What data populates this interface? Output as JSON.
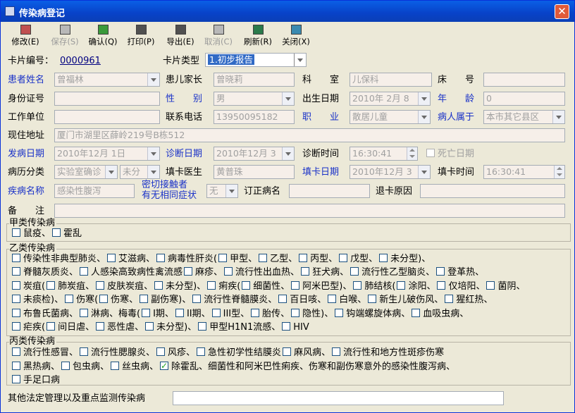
{
  "window": {
    "title": "传染病登记"
  },
  "toolbar": [
    {
      "label": "修改(E)",
      "icon": "edit-icon",
      "enabled": true
    },
    {
      "label": "保存(S)",
      "icon": "save-icon",
      "enabled": false
    },
    {
      "label": "确认(Q)",
      "icon": "confirm-icon",
      "enabled": true
    },
    {
      "label": "打印(P)",
      "icon": "print-icon",
      "enabled": true
    },
    {
      "label": "导出(E)",
      "icon": "export-icon",
      "enabled": true
    },
    {
      "label": "取消(C)",
      "icon": "cancel-icon",
      "enabled": false
    },
    {
      "label": "刷新(R)",
      "icon": "refresh-icon",
      "enabled": true
    },
    {
      "label": "关闭(X)",
      "icon": "close-icon",
      "enabled": true
    }
  ],
  "form": {
    "card_no_label": "卡片编号：",
    "card_no": "0000961",
    "card_type_label": "卡片类型",
    "card_type": "1.初步报告",
    "patient_name_label": "患者姓名",
    "patient_name": "曾福林",
    "guardian_label": "患儿家长",
    "guardian": "曾晓莉",
    "dept_label": "科　　室",
    "dept": "儿保科",
    "bed_label": "床　　号",
    "bed": "",
    "id_label": "身份证号",
    "id_no": "",
    "sex_label": "性　　别",
    "sex": "男",
    "birth_label": "出生日期",
    "birth": "2010年 2月 8",
    "age_label": "年　　龄",
    "age": "0",
    "work_label": "工作单位",
    "work": "",
    "phone_label": "联系电话",
    "phone": "13950095182",
    "job_label": "职　　业",
    "job": "散居儿童",
    "belong_label": "病人属于",
    "belong": "本市其它县区",
    "addr_label": "现住地址",
    "addr": "厦门市湖里区薛岭219号B栋512",
    "onset_label": "发病日期",
    "onset": "2010年12月 1日",
    "diag_date_label": "诊断日期",
    "diag_date": "2010年12月 3",
    "diag_time_label": "诊断时间",
    "diag_time": "16:30:41",
    "death_label": "死亡日期",
    "case_cls_label": "病历分类",
    "case_cls": "实验室确诊",
    "case_cls2": "未分",
    "doctor_label": "填卡医生",
    "doctor": "黄普珠",
    "fill_date_label": "填卡日期",
    "fill_date": "2010年12月 3",
    "fill_time_label": "填卡时间",
    "fill_time": "16:30:41",
    "disease_label": "疾病名称",
    "disease": "感染性腹泻",
    "contact_label1": "密切接触者",
    "contact_label2": "有无相同症状",
    "contact": "无",
    "revise_label": "订正病名",
    "revise": "",
    "return_label": "退卡原因",
    "return_reason": "",
    "remark_label": "备　　注",
    "remark": ""
  },
  "groupA": {
    "title": "甲类传染病",
    "rows": [
      [
        "鼠疫、",
        "霍乱"
      ]
    ]
  },
  "groupB": {
    "title": "乙类传染病",
    "rows": [
      [
        "传染性非典型肺炎、",
        "艾滋病、",
        "病毒性肝炎(",
        "甲型、",
        "乙型、",
        "丙型、",
        "戊型、",
        "未分型)、"
      ],
      [
        "脊髓灰质炎、",
        "人感染高致病性禽流感",
        "麻疹、",
        "流行性出血热、",
        "狂犬病、",
        "流行性乙型脑炎、",
        "登革热、"
      ],
      [
        "炭疽(",
        "肺炭疽、",
        "皮肤炭疽、",
        "未分型)、",
        "痢疾(",
        "细菌性、",
        "阿米巴型)、",
        "肺结核(",
        "涂阳、",
        "仅培阳、",
        "菌阴、"
      ],
      [
        "未痰检)、",
        "伤寒(",
        "伤寒、",
        "副伤寒)、",
        "流行性脊髓膜炎、",
        "百日咳、",
        "白喉、",
        "新生儿破伤风、",
        "猩红热、"
      ],
      [
        "布鲁氏菌病、",
        "淋病、梅毒(",
        "I期、",
        "II期、",
        "III型、",
        "胎传、",
        "隐性)、",
        "钩端螺旋体病、",
        "血吸虫病、"
      ],
      [
        "疟疾(",
        "间日虐、",
        "恶性虐、",
        "未分型)、",
        "甲型H1N1流感、",
        "HIV"
      ]
    ]
  },
  "groupC": {
    "title": "丙类传染病",
    "rows": [
      [
        "流行性感冒、",
        "流行性腮腺炎、",
        "风疹、",
        "急性初学性结膜炎",
        "麻风病、",
        "流行性和地方性斑疹伤寒"
      ],
      [
        "黑热病、",
        "包虫病、",
        "丝虫病、",
        "除霍乱、细菌性和阿米巴性痢疾、伤寒和副伤寒意外的感染性腹泻病、"
      ],
      [
        "手足口病"
      ]
    ]
  },
  "checked": {
    "groupC": [
      [
        1,
        3
      ]
    ]
  },
  "other_label": "其他法定管理以及重点监测传染病"
}
